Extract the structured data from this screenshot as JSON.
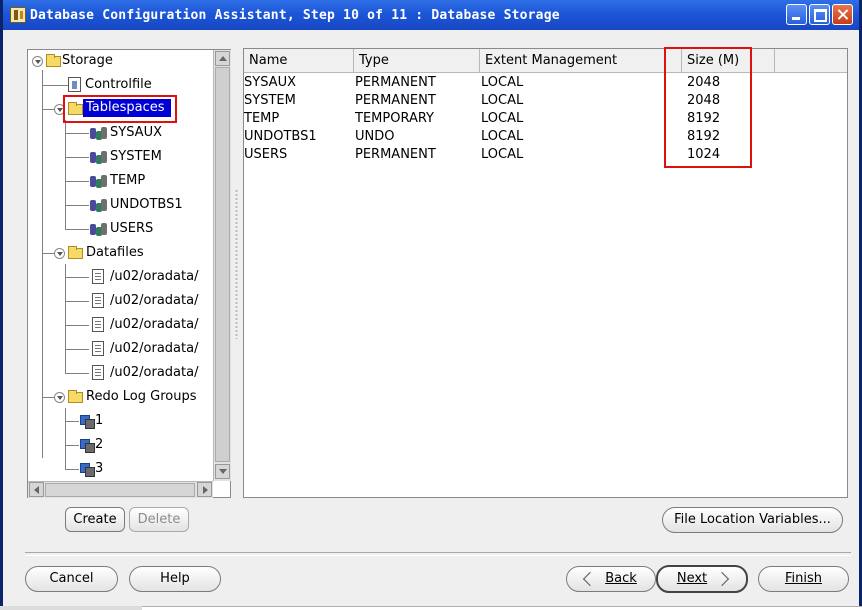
{
  "window": {
    "title": "Database Configuration Assistant, Step 10 of 11 : Database Storage"
  },
  "tree": {
    "storage": "Storage",
    "controlfile": "Controlfile",
    "tablespaces": "Tablespaces",
    "tablespace_items": [
      "SYSAUX",
      "SYSTEM",
      "TEMP",
      "UNDOTBS1",
      "USERS"
    ],
    "datafiles": "Datafiles",
    "datafile_items": [
      "/u02/oradata/",
      "/u02/oradata/",
      "/u02/oradata/",
      "/u02/oradata/",
      "/u02/oradata/"
    ],
    "redo_log_groups": "Redo Log Groups",
    "redo_items": [
      "1",
      "2",
      "3"
    ],
    "selected": "Tablespaces"
  },
  "table": {
    "columns": [
      "Name",
      "Type",
      "Extent Management",
      "Size (M)"
    ],
    "rows": [
      [
        "SYSAUX",
        "PERMANENT",
        "LOCAL",
        "2048"
      ],
      [
        "SYSTEM",
        "PERMANENT",
        "LOCAL",
        "2048"
      ],
      [
        "TEMP",
        "TEMPORARY",
        "LOCAL",
        "8192"
      ],
      [
        "UNDOTBS1",
        "UNDO",
        "LOCAL",
        "8192"
      ],
      [
        "USERS",
        "PERMANENT",
        "LOCAL",
        "1024"
      ]
    ]
  },
  "buttons": {
    "create": "Create",
    "delete": "Delete",
    "file_location_variables": "File Location Variables...",
    "cancel": "Cancel",
    "help": "Help",
    "back": "Back",
    "next": "Next",
    "finish": "Finish"
  },
  "colors": {
    "highlight_box": "#e01010",
    "selection": "#0000d6",
    "titlebar": "#1c56d8"
  }
}
